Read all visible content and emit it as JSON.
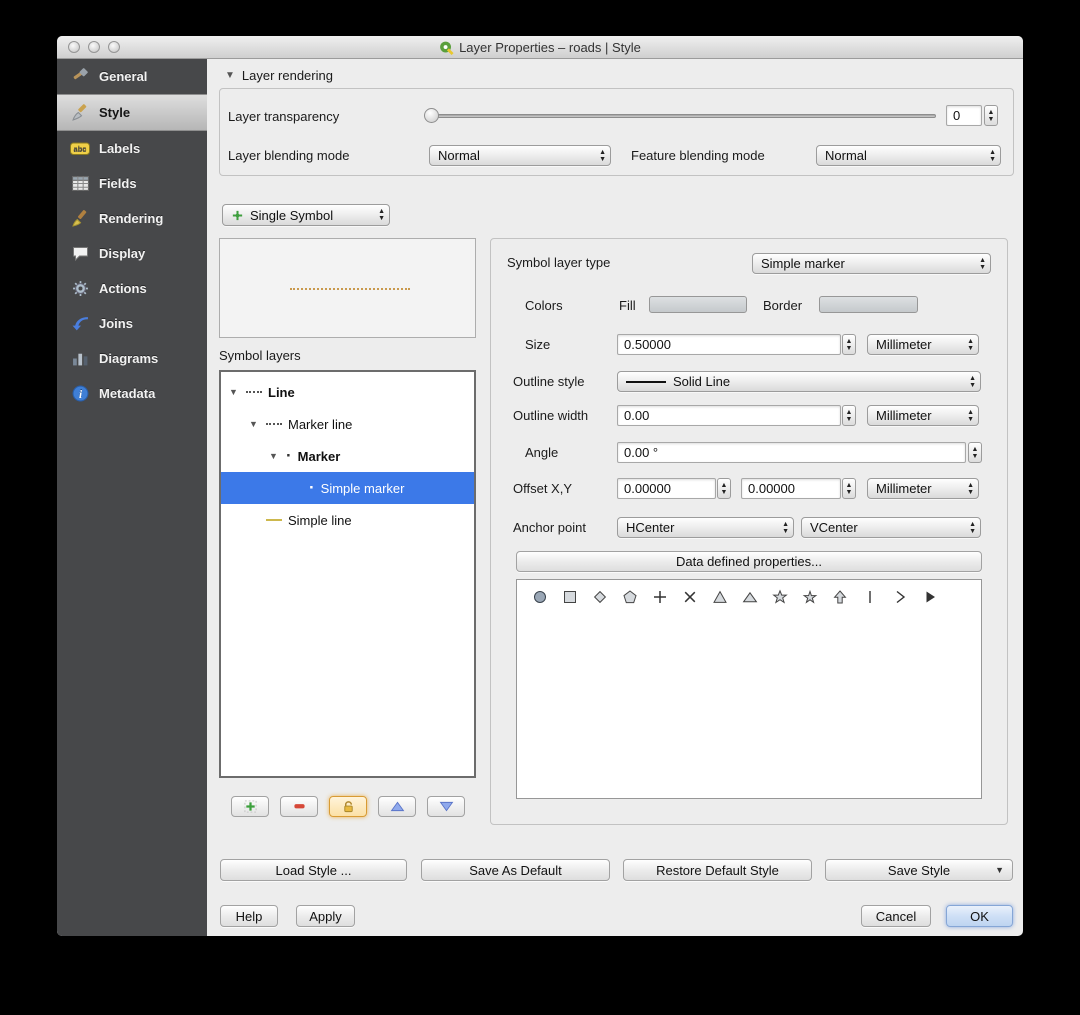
{
  "window": {
    "title": "Layer Properties – roads | Style"
  },
  "sidebar": {
    "items": [
      {
        "label": "General"
      },
      {
        "label": "Style"
      },
      {
        "label": "Labels"
      },
      {
        "label": "Fields"
      },
      {
        "label": "Rendering"
      },
      {
        "label": "Display"
      },
      {
        "label": "Actions"
      },
      {
        "label": "Joins"
      },
      {
        "label": "Diagrams"
      },
      {
        "label": "Metadata"
      }
    ]
  },
  "layer_rendering": {
    "section_label": "Layer rendering",
    "transparency_label": "Layer transparency",
    "transparency_value": "0",
    "blending_label": "Layer blending mode",
    "blending_value": "Normal",
    "feature_blending_label": "Feature blending mode",
    "feature_blending_value": "Normal"
  },
  "symbol": {
    "type_selector": "Single Symbol",
    "layers_label": "Symbol layers",
    "tree": [
      {
        "label": "Line"
      },
      {
        "label": "Marker line"
      },
      {
        "label": "Marker"
      },
      {
        "label": "Simple marker"
      },
      {
        "label": "Simple line"
      }
    ]
  },
  "properties": {
    "symbol_layer_type_label": "Symbol layer type",
    "symbol_layer_type_value": "Simple marker",
    "colors_label": "Colors",
    "fill_label": "Fill",
    "border_label": "Border",
    "size_label": "Size",
    "size_value": "0.50000",
    "size_unit": "Millimeter",
    "outline_style_label": "Outline style",
    "outline_style_value": "Solid Line",
    "outline_width_label": "Outline width",
    "outline_width_value": "0.00",
    "outline_width_unit": "Millimeter",
    "angle_label": "Angle",
    "angle_value": "0.00 °",
    "offset_label": "Offset X,Y",
    "offset_x_value": "0.00000",
    "offset_y_value": "0.00000",
    "offset_unit": "Millimeter",
    "anchor_label": "Anchor point",
    "anchor_h_value": "HCenter",
    "anchor_v_value": "VCenter",
    "data_defined_button": "Data defined properties...",
    "marker_shapes": [
      "circle",
      "square",
      "diamond",
      "pentagon",
      "cross",
      "cross2",
      "triangle",
      "equilateral_triangle",
      "star",
      "regular_star",
      "arrow",
      "line",
      "arrowhead",
      "filled_arrowhead"
    ]
  },
  "footer": {
    "load_style": "Load Style ...",
    "save_as_default": "Save As Default",
    "restore_default": "Restore Default Style",
    "save_style": "Save Style",
    "help": "Help",
    "apply": "Apply",
    "cancel": "Cancel",
    "ok": "OK"
  },
  "colors": {
    "accent_blue": "#3c79e8",
    "sidebar_dark": "#47484a",
    "marker_dot_line": "#c9994d"
  }
}
